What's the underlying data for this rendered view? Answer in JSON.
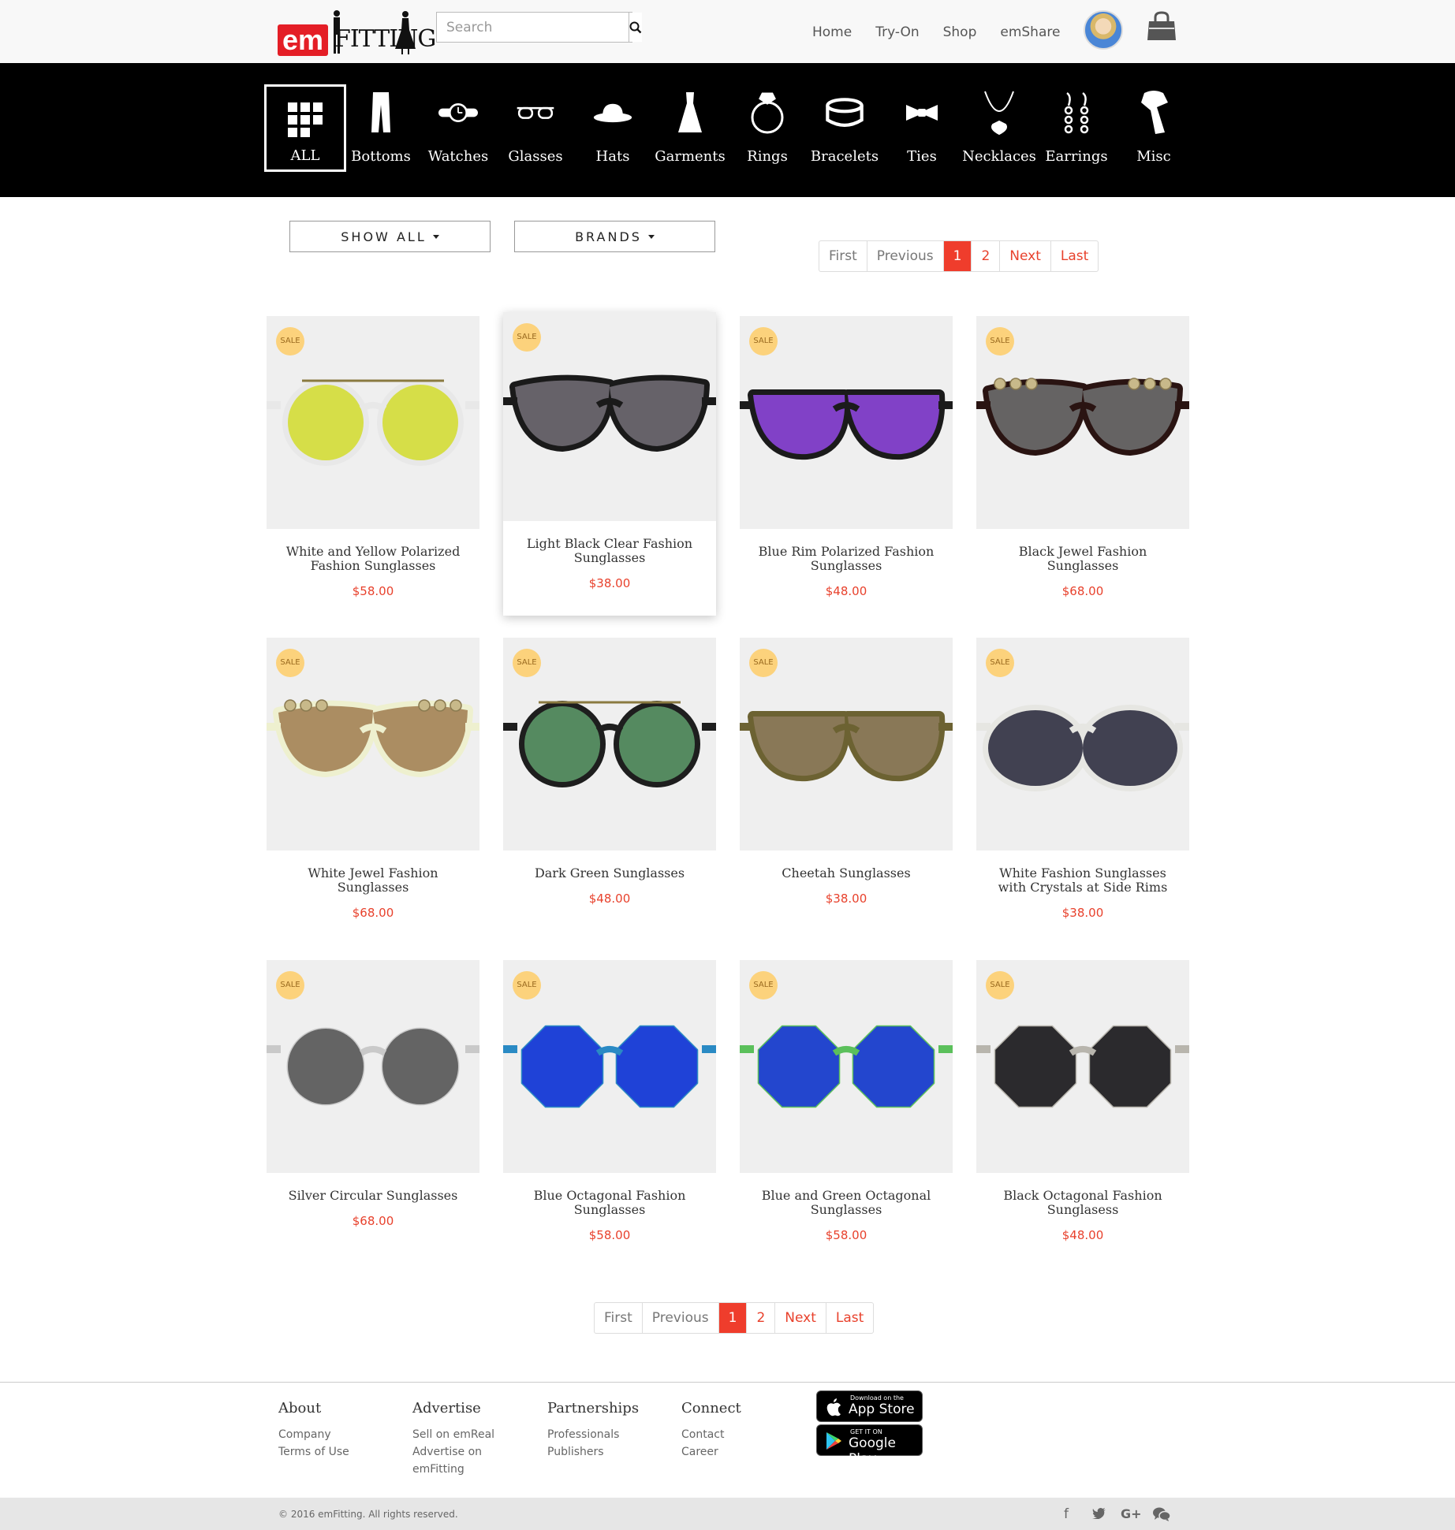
{
  "header": {
    "logo_em": "em",
    "logo_fitting": "FITTING",
    "search_placeholder": "Search",
    "nav": [
      "Home",
      "Try-On",
      "Shop",
      "emShare"
    ]
  },
  "categories": [
    {
      "label": "ALL",
      "icon": "grid-icon",
      "active": true
    },
    {
      "label": "Bottoms",
      "icon": "pants-icon"
    },
    {
      "label": "Watches",
      "icon": "watch-icon"
    },
    {
      "label": "Glasses",
      "icon": "glasses-icon"
    },
    {
      "label": "Hats",
      "icon": "hat-icon"
    },
    {
      "label": "Garments",
      "icon": "dress-icon"
    },
    {
      "label": "Rings",
      "icon": "ring-icon"
    },
    {
      "label": "Bracelets",
      "icon": "bracelet-icon"
    },
    {
      "label": "Ties",
      "icon": "bowtie-icon"
    },
    {
      "label": "Necklaces",
      "icon": "necklace-icon"
    },
    {
      "label": "Earrings",
      "icon": "earrings-icon"
    },
    {
      "label": "Misc",
      "icon": "scarf-icon"
    }
  ],
  "filters": {
    "show_all": "SHOW ALL",
    "brands": "BRANDS"
  },
  "pagination": {
    "first": "First",
    "previous": "Previous",
    "pages": [
      "1",
      "2"
    ],
    "current": "1",
    "next": "Next",
    "last": "Last"
  },
  "sale_badge": "SALE",
  "products": [
    {
      "name": "White and Yellow Polarized Fashion Sunglasses",
      "price": "$58.00",
      "frame": "#e8e8e8",
      "lens": "#d4dc3a"
    },
    {
      "name": "Light Black Clear Fashion Sunglasses",
      "price": "$38.00",
      "frame": "#1a1a1a",
      "lens": "#6d6870"
    },
    {
      "name": "Blue Rim Polarized Fashion Sunglasses",
      "price": "$48.00",
      "frame": "#1b1b1b",
      "lens": "#8a44d6"
    },
    {
      "name": "Black Jewel Fashion Sunglasses",
      "price": "$68.00",
      "frame": "#2a1412",
      "lens": "#6a6a6a"
    },
    {
      "name": "White Jewel Fashion Sunglasses",
      "price": "$68.00",
      "frame": "#eef0cf",
      "lens": "#a58459"
    },
    {
      "name": "Dark Green Sunglasses",
      "price": "$48.00",
      "frame": "#1e1e1e",
      "lens": "#5a9466"
    },
    {
      "name": "Cheetah Sunglasses",
      "price": "$38.00",
      "frame": "#6c6232",
      "lens": "#8c7a5a"
    },
    {
      "name": "White Fashion Sunglasses with Crystals at Side Rims",
      "price": "$38.00",
      "frame": "#e6e6e2",
      "lens": "#333344"
    },
    {
      "name": "Silver Circular Sunglasses",
      "price": "$68.00",
      "frame": "#c9c9c9",
      "lens": "#5b5b5b"
    },
    {
      "name": "Blue Octagonal Fashion Sunglasses",
      "price": "$58.00",
      "frame": "#2a8ac4",
      "lens": "#1e3cd8"
    },
    {
      "name": "Blue and Green Octagonal Sunglasses",
      "price": "$58.00",
      "frame": "#5bc05b",
      "lens": "#1e3cd8"
    },
    {
      "name": "Black Octagonal Fashion Sunglasess",
      "price": "$48.00",
      "frame": "#b8b5ad",
      "lens": "#1e1e22"
    }
  ],
  "footer": {
    "columns": [
      {
        "title": "About",
        "links": [
          "Company",
          "Terms of Use"
        ]
      },
      {
        "title": "Advertise",
        "links": [
          "Sell on emReal",
          "Advertise on",
          "emFitting"
        ]
      },
      {
        "title": "Partnerships",
        "links": [
          "Professionals",
          "Publishers"
        ]
      },
      {
        "title": "Connect",
        "links": [
          "Contact",
          "Career"
        ]
      }
    ],
    "app_store_small": "Download on the",
    "app_store_big": "App Store",
    "google_small": "GET IT ON",
    "google_big": "Google Play",
    "copyright": "© 2016 emFitting. All rights reserved.",
    "social": [
      "facebook-icon",
      "twitter-icon",
      "google-plus-icon",
      "wechat-icon"
    ]
  }
}
